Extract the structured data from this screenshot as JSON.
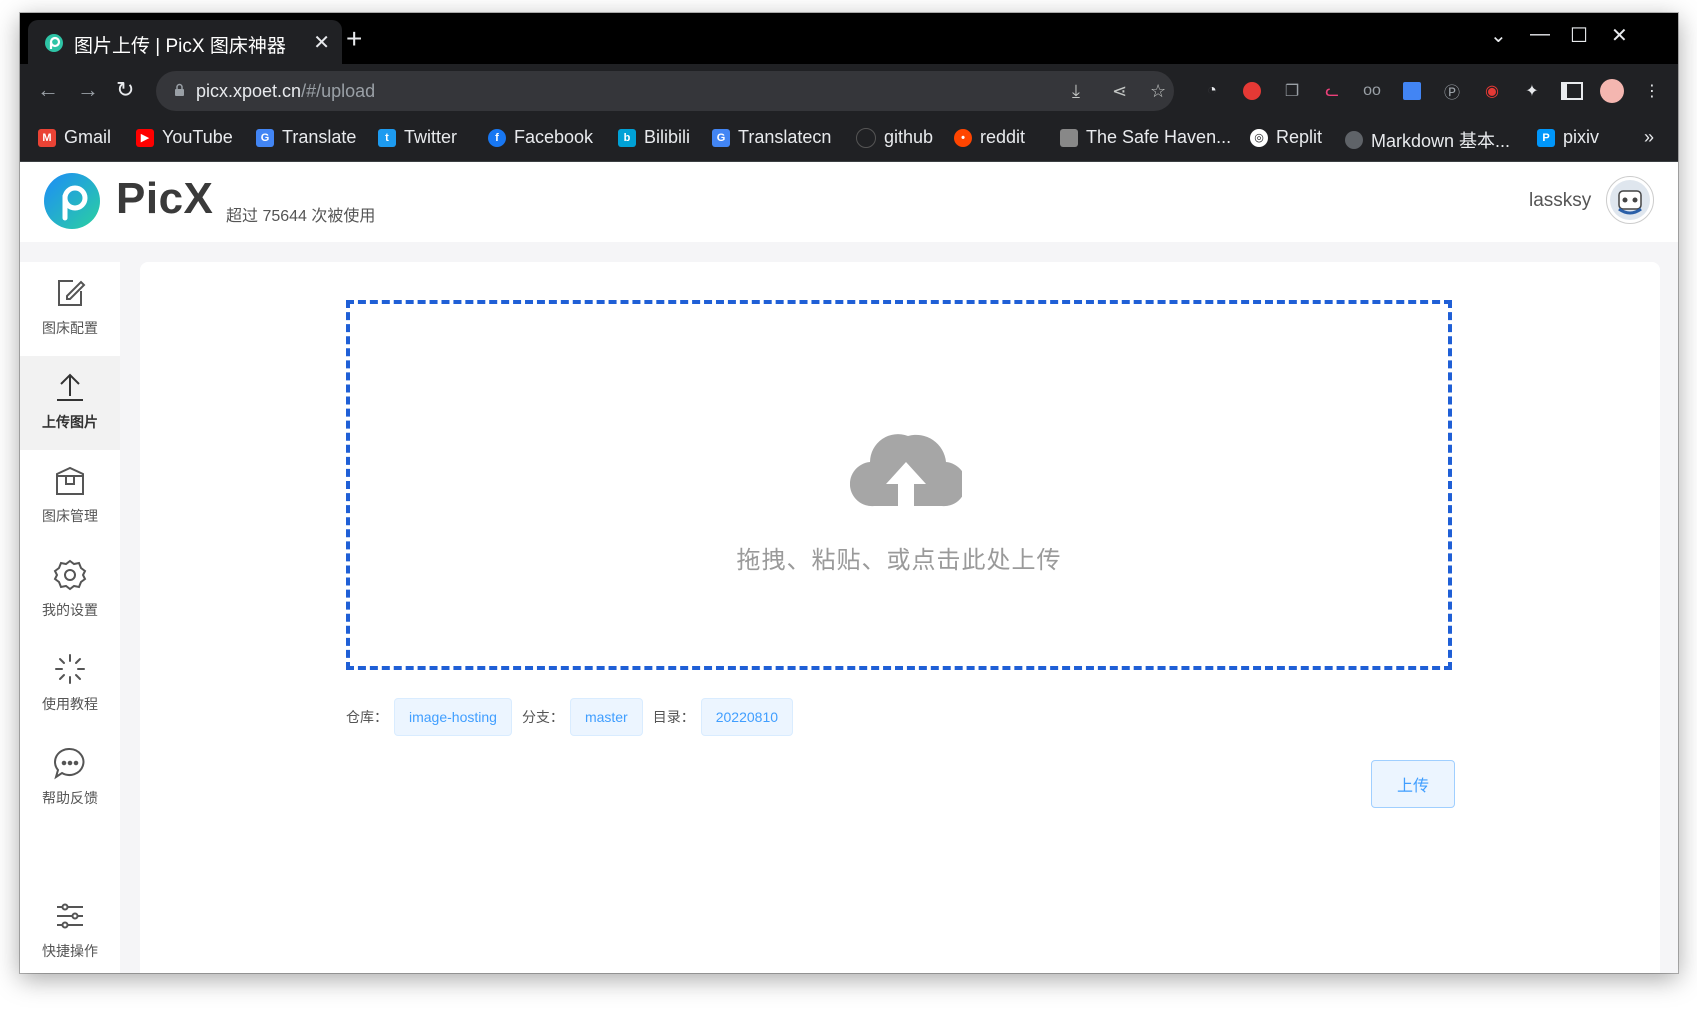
{
  "browser": {
    "tab_title": "图片上传 | PicX 图床神器",
    "tab_close": "✕",
    "new_tab": "+",
    "url_host": "picx.xpoet.cn",
    "url_path": "/#/upload",
    "window_controls": {
      "dropdown": "⌄",
      "minimize": "—",
      "maximize": "☐",
      "close": "✕"
    },
    "bookmarks": [
      {
        "label": "Gmail",
        "icon": "gmail-icon",
        "color": "#ea4335"
      },
      {
        "label": "YouTube",
        "icon": "youtube-icon",
        "color": "#ff0000"
      },
      {
        "label": "Translate",
        "icon": "google-translate-icon",
        "color": "#4285f4"
      },
      {
        "label": "Twitter",
        "icon": "twitter-icon",
        "color": "#1d9bf0"
      },
      {
        "label": "Facebook",
        "icon": "facebook-icon",
        "color": "#1877f2"
      },
      {
        "label": "Bilibili",
        "icon": "bilibili-icon",
        "color": "#00a1d6"
      },
      {
        "label": "Translatecn",
        "icon": "google-translate-icon",
        "color": "#4285f4"
      },
      {
        "label": "github",
        "icon": "github-icon",
        "color": "#24292f"
      },
      {
        "label": "reddit",
        "icon": "reddit-icon",
        "color": "#ff4500"
      },
      {
        "label": "The Safe Haven...",
        "icon": "safe-haven-icon",
        "color": "#888888"
      },
      {
        "label": "Replit",
        "icon": "replit-icon",
        "color": "#ffffff"
      },
      {
        "label": "Markdown 基本...",
        "icon": "markdown-icon",
        "color": "#9aa0a6"
      },
      {
        "label": "pixiv",
        "icon": "pixiv-icon",
        "color": "#0096fa"
      }
    ],
    "bookmarks_overflow": "»"
  },
  "header": {
    "brand": "PicX",
    "usage": "超过 75644 次被使用",
    "username": "lassksy"
  },
  "sidebar": {
    "items": [
      {
        "label": "图床配置",
        "icon": "edit-icon"
      },
      {
        "label": "上传图片",
        "icon": "upload-icon",
        "active": true
      },
      {
        "label": "图床管理",
        "icon": "box-icon"
      },
      {
        "label": "我的设置",
        "icon": "gear-icon"
      },
      {
        "label": "使用教程",
        "icon": "loading-icon"
      },
      {
        "label": "帮助反馈",
        "icon": "chat-icon"
      },
      {
        "label": "快捷操作",
        "icon": "sliders-icon"
      }
    ]
  },
  "upload": {
    "drop_text": "拖拽、粘贴、或点击此处上传",
    "repo_label": "仓库：",
    "repo_value": "image-hosting",
    "branch_label": "分支：",
    "branch_value": "master",
    "dir_label": "目录：",
    "dir_value": "20220810",
    "upload_button": "上传"
  },
  "colors": {
    "accent": "#409eff",
    "dropzone_border": "#1f5fd6",
    "cloud": "#a6a6a6"
  }
}
